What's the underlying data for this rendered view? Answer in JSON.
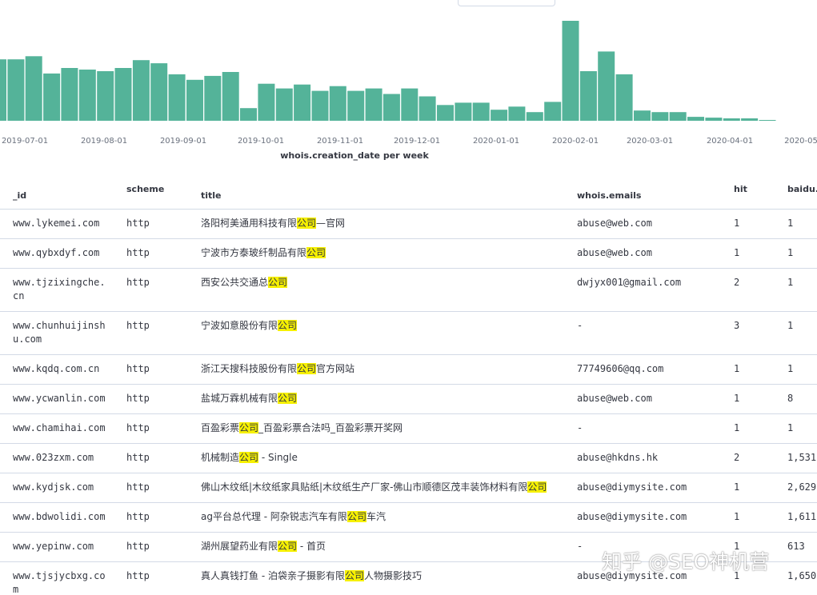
{
  "chart_data": {
    "type": "bar",
    "title": "whois.creation_date per week",
    "x_tick_labels": [
      "2019-07-01",
      "2019-08-01",
      "2019-09-01",
      "2019-10-01",
      "2019-11-01",
      "2019-12-01",
      "2020-01-01",
      "2020-02-01",
      "2020-03-01",
      "2020-04-01",
      "2020-05"
    ],
    "values": [
      78,
      78,
      82,
      60,
      67,
      65,
      63,
      67,
      77,
      73,
      59,
      52,
      57,
      62,
      16,
      47,
      41,
      46,
      38,
      44,
      38,
      41,
      34,
      41,
      31,
      20,
      23,
      23,
      14,
      18,
      11,
      24,
      127,
      63,
      88,
      59,
      13,
      11,
      11,
      5,
      4,
      3,
      3,
      1
    ],
    "ylim": [
      0,
      130
    ],
    "grid": false
  },
  "table": {
    "columns": [
      {
        "key": "_id",
        "label": "_id"
      },
      {
        "key": "scheme",
        "label": "scheme"
      },
      {
        "key": "title",
        "label": "title"
      },
      {
        "key": "emails",
        "label": "whois.emails"
      },
      {
        "key": "hit",
        "label": "hit"
      },
      {
        "key": "baidu",
        "label": "baidu."
      }
    ],
    "rows": [
      {
        "_id": "www.lykemei.com",
        "scheme": "http",
        "title_pre": "洛阳柯美通用科技有限",
        "title_hl": "公司",
        "title_post": "—官网",
        "emails": "abuse@web.com",
        "hit": "1",
        "baidu": "1"
      },
      {
        "_id": "www.qybxdyf.com",
        "scheme": "http",
        "title_pre": "宁波市方泰玻纤制品有限",
        "title_hl": "公司",
        "title_post": "",
        "emails": "abuse@web.com",
        "hit": "1",
        "baidu": "1"
      },
      {
        "_id": "www.tjzixingche.cn",
        "scheme": "http",
        "title_pre": "西安公共交通总",
        "title_hl": "公司",
        "title_post": "",
        "emails": "dwjyx001@gmail.com",
        "hit": "2",
        "baidu": "1"
      },
      {
        "_id": "www.chunhuijinshu.com",
        "scheme": "http",
        "title_pre": "宁波如意股份有限",
        "title_hl": "公司",
        "title_post": "",
        "emails": " -",
        "hit": "3",
        "baidu": "1"
      },
      {
        "_id": "www.kqdq.com.cn",
        "scheme": "http",
        "title_pre": "浙江天搜科技股份有限",
        "title_hl": "公司",
        "title_post": "官方网站",
        "emails": "77749606@qq.com",
        "hit": "1",
        "baidu": "1"
      },
      {
        "_id": "www.ycwanlin.com",
        "scheme": "http",
        "title_pre": "盐城万霖机械有限",
        "title_hl": "公司",
        "title_post": "",
        "emails": "abuse@web.com",
        "hit": "1",
        "baidu": "8"
      },
      {
        "_id": "www.chamihai.com",
        "scheme": "http",
        "title_pre": "百盈彩票",
        "title_hl": "公司",
        "title_post": "_百盈彩票合法吗_百盈彩票开奖网",
        "emails": " -",
        "hit": "1",
        "baidu": "1"
      },
      {
        "_id": "www.023zxm.com",
        "scheme": "http",
        "title_pre": "机械制造",
        "title_hl": "公司",
        "title_post": " - Single",
        "emails": "abuse@hkdns.hk",
        "hit": "2",
        "baidu": "1,531"
      },
      {
        "_id": "www.kydjsk.com",
        "scheme": "http",
        "title_pre": "佛山木纹纸|木纹纸家具贴纸|木纹纸生产厂家-佛山市顺德区茂丰装饰材料有限",
        "title_hl": "公司",
        "title_post": "",
        "emails": "abuse@diymysite.com",
        "hit": "1",
        "baidu": "2,629"
      },
      {
        "_id": "www.bdwolidi.com",
        "scheme": "http",
        "title_pre": "ag平台总代理 - 阿杂锐志汽车有限",
        "title_hl": "公司",
        "title_post": "车汽",
        "emails": "abuse@diymysite.com",
        "hit": "1",
        "baidu": "1,611"
      },
      {
        "_id": "www.yepinw.com",
        "scheme": "http",
        "title_pre": "湖州展望药业有限",
        "title_hl": "公司",
        "title_post": " - 首页",
        "emails": " -",
        "hit": "1",
        "baidu": "613"
      },
      {
        "_id": "www.tjsjycbxg.com",
        "scheme": "http",
        "title_pre": "真人真钱打鱼 - 泊袋亲子摄影有限",
        "title_hl": "公司",
        "title_post": "人物摄影技巧",
        "emails": "abuse@diymysite.com",
        "hit": "1",
        "baidu": "1,650"
      }
    ]
  },
  "watermark": "知乎 @SEO神机营",
  "colors": {
    "bar": "#54b399",
    "highlight": "#f6f000",
    "border": "#d3dae6"
  }
}
